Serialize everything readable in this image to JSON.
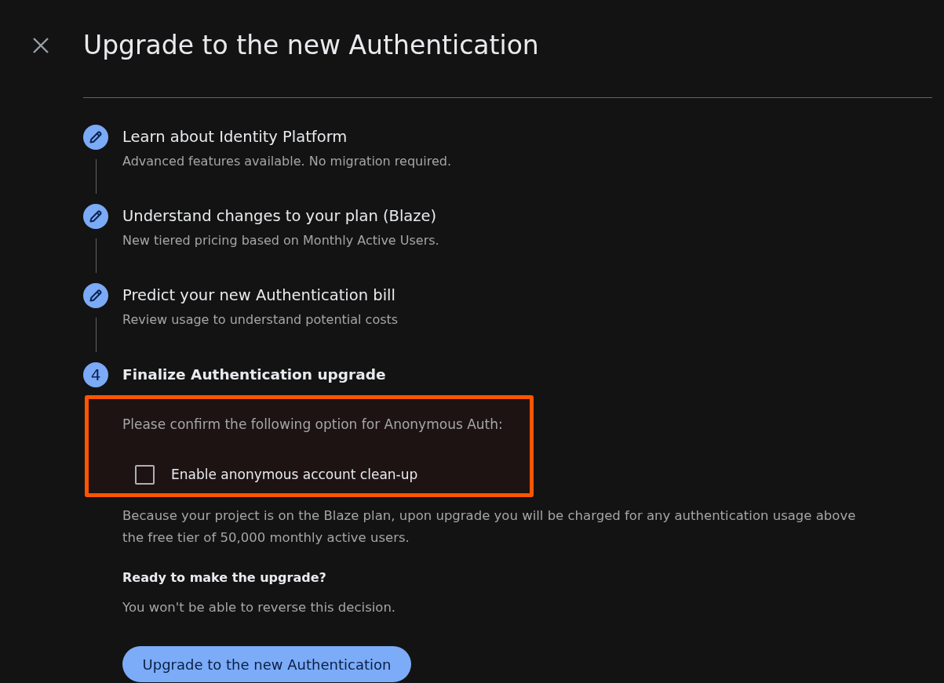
{
  "title": "Upgrade to the new Authentication",
  "steps": [
    {
      "kind": "completed",
      "title": "Learn about Identity Platform",
      "subtitle": "Advanced features available. No migration required."
    },
    {
      "kind": "completed",
      "title": "Understand changes to your plan (Blaze)",
      "subtitle": "New tiered pricing based on Monthly Active Users."
    },
    {
      "kind": "completed",
      "title": "Predict your new Authentication bill",
      "subtitle": "Review usage to understand potential costs"
    },
    {
      "kind": "current",
      "number": "4",
      "title": "Finalize Authentication upgrade"
    }
  ],
  "confirmation": {
    "highlighted": true,
    "prompt": "Please confirm the following option for Anonymous Auth:",
    "option": {
      "label": "Enable anonymous account clean-up",
      "checked": false
    }
  },
  "notice": "Because your project is on the Blaze plan, upon upgrade you will be charged for any authentication usage above the free tier of 50,000 monthly active users.",
  "question": "Ready to make the upgrade?",
  "warning": "You won't be able to reverse this decision.",
  "primary_button": "Upgrade to the new Authentication"
}
